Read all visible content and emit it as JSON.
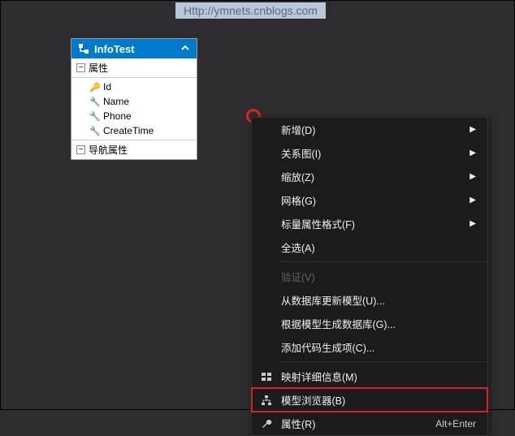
{
  "watermark": "Http://ymnets.cnblogs.com",
  "entity": {
    "title": "InfoTest",
    "sections": {
      "properties": {
        "label": "属性",
        "items": [
          "Id",
          "Name",
          "Phone",
          "CreateTime"
        ]
      },
      "navigation": {
        "label": "导航属性"
      }
    }
  },
  "menu": {
    "items": [
      {
        "label": "新增(D)",
        "arrow": true
      },
      {
        "label": "关系图(I)",
        "arrow": true
      },
      {
        "label": "缩放(Z)",
        "arrow": true
      },
      {
        "label": "网格(G)",
        "arrow": true
      },
      {
        "label": "标量属性格式(F)",
        "arrow": true
      },
      {
        "label": "全选(A)"
      },
      {
        "sep": true
      },
      {
        "label": "验证(V)",
        "disabled": true
      },
      {
        "label": "从数据库更新模型(U)..."
      },
      {
        "label": "根据模型生成数据库(G)..."
      },
      {
        "label": "添加代码生成项(C)..."
      },
      {
        "sep": true
      },
      {
        "label": "映射详细信息(M)",
        "icon": "map"
      },
      {
        "label": "模型浏览器(B)",
        "icon": "tree",
        "highlight": true
      },
      {
        "label": "属性(R)",
        "icon": "wrench",
        "shortcut": "Alt+Enter"
      }
    ]
  }
}
